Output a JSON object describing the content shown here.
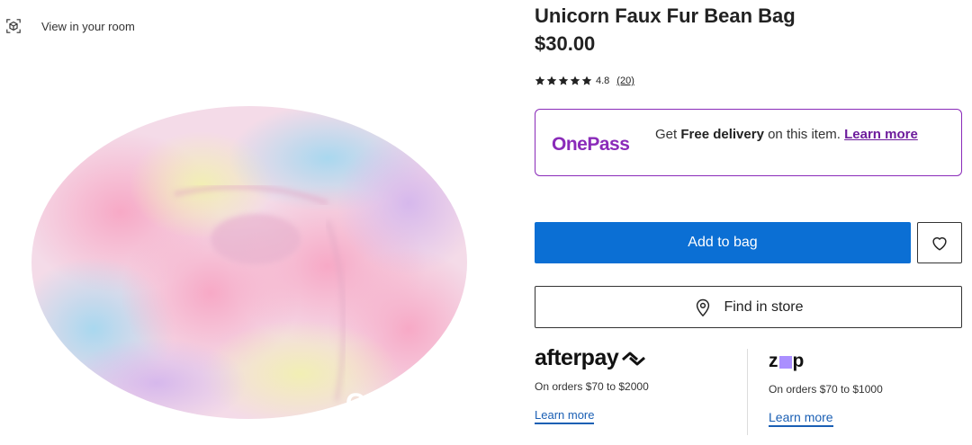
{
  "gallery": {
    "view_in_room_label": "View in your room",
    "view_in_room_icon": "ar-cube-icon",
    "overlay_text": "C"
  },
  "product": {
    "title": "Unicorn Faux Fur Bean Bag",
    "price": "$30.00",
    "rating": {
      "stars": 5,
      "value": "4.8",
      "reviews": "(20)"
    }
  },
  "onepass": {
    "logo": "OnePass",
    "text_prefix": "Get ",
    "text_bold": "Free delivery",
    "text_suffix": " on this item. ",
    "learn_more": "Learn more",
    "brand_color": "#8a2bb9"
  },
  "actions": {
    "add_to_bag": "Add to bag",
    "wishlist_icon": "heart-icon",
    "find_in_store": "Find in store",
    "find_in_store_icon": "map-pin-icon",
    "primary_color": "#0b6fd4"
  },
  "payments": {
    "afterpay": {
      "logo": "afterpay",
      "subtitle": "On orders $70 to $2000",
      "learn_more": "Learn more"
    },
    "zip": {
      "logo_left": "z",
      "logo_right": "p",
      "subtitle": "On orders $70 to $1000",
      "learn_more": "Learn more"
    }
  }
}
